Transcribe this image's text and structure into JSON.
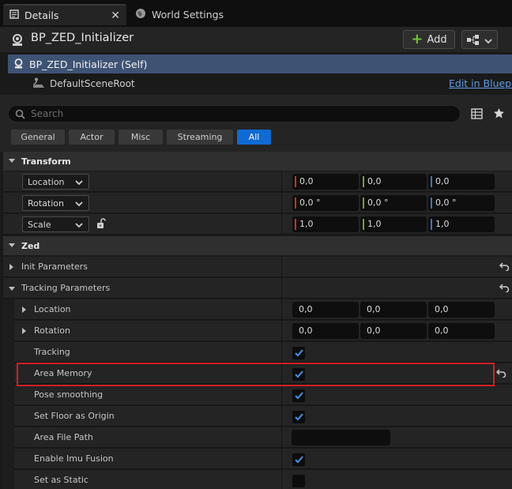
{
  "tabs": [
    {
      "label": "Details",
      "icon": "details-icon",
      "active": true
    },
    {
      "label": "World Settings",
      "icon": "globe-icon",
      "active": false
    }
  ],
  "header": {
    "title": "BP_ZED_Initializer",
    "add_label": "Add"
  },
  "tree": {
    "self_label": "BP_ZED_Initializer (Self)",
    "child_label": "DefaultSceneRoot",
    "edit_link": "Edit in Blueprint"
  },
  "search": {
    "placeholder": "Search"
  },
  "filters": [
    {
      "label": "General",
      "active": false
    },
    {
      "label": "Actor",
      "active": false
    },
    {
      "label": "Misc",
      "active": false
    },
    {
      "label": "Streaming",
      "active": false
    },
    {
      "label": "All",
      "active": true
    }
  ],
  "transform": {
    "section_label": "Transform",
    "rows": [
      {
        "label": "Location",
        "values": [
          "0,0",
          "0,0",
          "0,0"
        ]
      },
      {
        "label": "Rotation",
        "values": [
          "0,0 °",
          "0,0 °",
          "0,0 °"
        ]
      },
      {
        "label": "Scale",
        "values": [
          "1,0",
          "1,0",
          "1,0"
        ]
      }
    ]
  },
  "zed": {
    "section_label": "Zed",
    "init_parameters": "Init Parameters",
    "tracking_parameters": "Tracking Parameters",
    "location": {
      "label": "Location",
      "values": [
        "0,0",
        "0,0",
        "0,0"
      ]
    },
    "rotation": {
      "label": "Rotation",
      "values": [
        "0,0",
        "0,0",
        "0,0"
      ]
    },
    "tracking": {
      "label": "Tracking",
      "checked": true
    },
    "area_memory": {
      "label": "Area Memory",
      "checked": true
    },
    "pose_smoothing": {
      "label": "Pose smoothing",
      "checked": true
    },
    "set_floor_as_origin": {
      "label": "Set Floor as Origin",
      "checked": true
    },
    "area_file_path": {
      "label": "Area File Path",
      "value": ""
    },
    "enable_imu_fusion": {
      "label": "Enable Imu Fusion",
      "checked": true
    },
    "set_as_static": {
      "label": "Set as Static",
      "checked": false
    }
  },
  "colors": {
    "axis_x": "#c7332b",
    "axis_y": "#6da53a",
    "axis_z": "#3e73c9",
    "highlight": "#d21f26",
    "selection": "#3e5374",
    "active_filter": "#0f6ad4"
  }
}
